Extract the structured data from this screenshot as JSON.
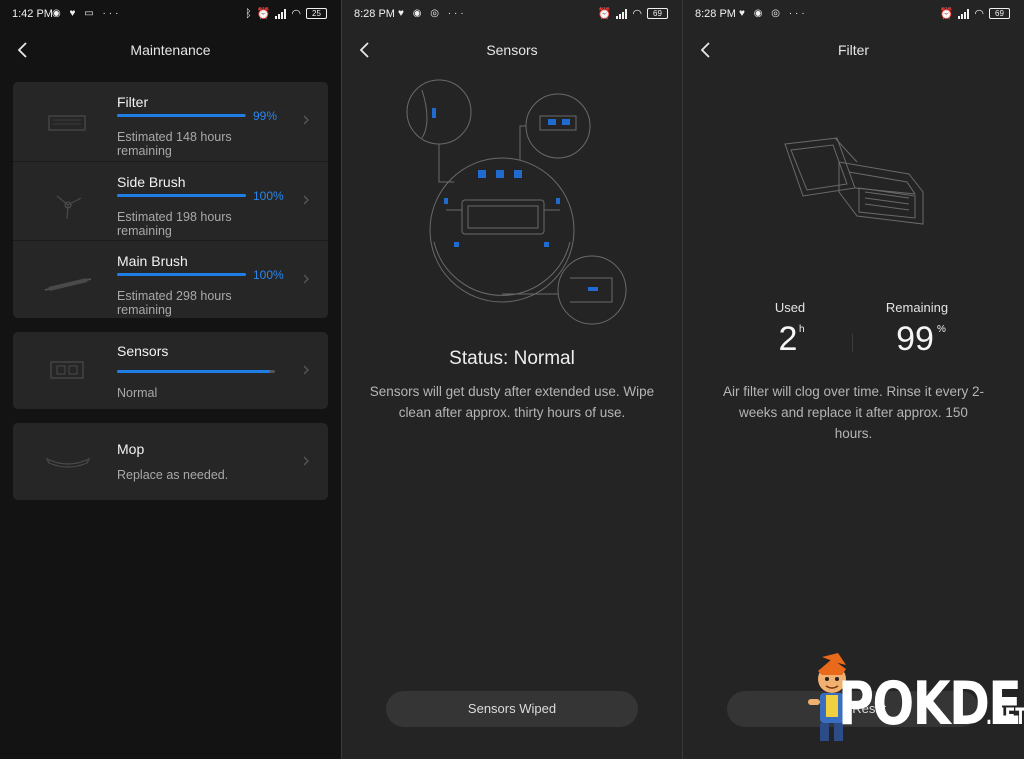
{
  "screens": {
    "maintenance": {
      "status": {
        "time": "1:42 PM",
        "battery": "25"
      },
      "title": "Maintenance",
      "items": [
        {
          "name": "Filter",
          "percent": "99%",
          "level": 0.99,
          "remaining": "Estimated 148 hours remaining"
        },
        {
          "name": "Side Brush",
          "percent": "100%",
          "level": 1.0,
          "remaining": "Estimated 198 hours remaining"
        },
        {
          "name": "Main Brush",
          "percent": "100%",
          "level": 1.0,
          "remaining": "Estimated 298 hours remaining"
        }
      ],
      "sensors": {
        "name": "Sensors",
        "status": "Normal",
        "level": 0.97
      },
      "mop": {
        "name": "Mop",
        "note": "Replace as needed."
      }
    },
    "sensors": {
      "status": {
        "time": "8:28 PM",
        "battery": "69"
      },
      "title": "Sensors",
      "status_line": "Status:  Normal",
      "description": "Sensors will get dusty after extended use. Wipe clean after approx. thirty hours of use.",
      "button": "Sensors Wiped"
    },
    "filter": {
      "status": {
        "time": "8:28 PM",
        "battery": "69"
      },
      "title": "Filter",
      "used_label": "Used",
      "used_value": "2",
      "used_unit": "h",
      "remaining_label": "Remaining",
      "remaining_value": "99",
      "remaining_unit": "%",
      "description": "Air filter will clog over time. Rinse it every 2-weeks and replace it after approx. 150 hours.",
      "button": "Filter Reset"
    }
  },
  "watermark": {
    "brand": "POKDE",
    "suffix": ".NET"
  },
  "colors": {
    "accent": "#1f7de6",
    "card": "#262626",
    "panel": "#242424"
  }
}
